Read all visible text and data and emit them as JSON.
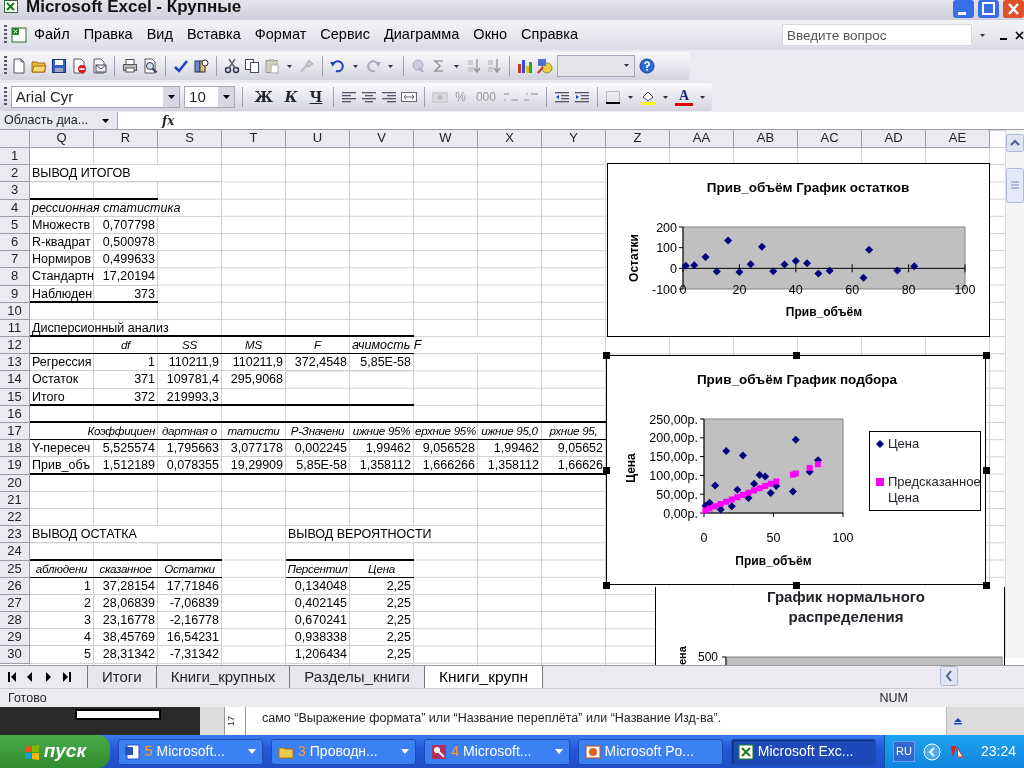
{
  "window": {
    "title": "Microsoft Excel - Крупные"
  },
  "menu": [
    "Файл",
    "Правка",
    "Вид",
    "Вставка",
    "Формат",
    "Сервис",
    "Диаграмма",
    "Окно",
    "Справка"
  ],
  "help_search": {
    "placeholder": "Введите вопрос"
  },
  "formatting": {
    "font": "Arial Cyr",
    "size": "10",
    "style_buttons": [
      "Ж",
      "К",
      "Ч"
    ],
    "number_buttons": [
      "%",
      "000"
    ],
    "font_color_button": "A"
  },
  "formula_bar": {
    "name_box": "Область диа...",
    "fx": "fx"
  },
  "columns": [
    "Q",
    "R",
    "S",
    "T",
    "U",
    "V",
    "W",
    "X",
    "Y",
    "Z",
    "AA",
    "AB",
    "AC",
    "AD",
    "AE"
  ],
  "rows": [
    {
      "number": "1"
    },
    {
      "number": "2",
      "cells": {
        "Q": {
          "kind": "text",
          "text": "ВЫВОД ИТОГОВ"
        }
      }
    },
    {
      "number": "3",
      "thick_rule": {
        "Q": true,
        "R": true
      }
    },
    {
      "number": "4",
      "cells": {
        "Q": {
          "kind": "italic-text",
          "text": "рессионная статистика"
        }
      }
    },
    {
      "number": "5",
      "cells": {
        "Q": {
          "kind": "text",
          "text": "Множеств"
        },
        "R": {
          "kind": "number",
          "text": "0,707798"
        }
      }
    },
    {
      "number": "6",
      "cells": {
        "Q": {
          "kind": "text",
          "text": "R-квадрат"
        },
        "R": {
          "kind": "number",
          "text": "0,500978"
        }
      }
    },
    {
      "number": "7",
      "cells": {
        "Q": {
          "kind": "text",
          "text": "Нормиров"
        },
        "R": {
          "kind": "number",
          "text": "0,499633"
        }
      }
    },
    {
      "number": "8",
      "cells": {
        "Q": {
          "kind": "text",
          "text": "Стандартн"
        },
        "R": {
          "kind": "number",
          "text": "17,20194"
        }
      }
    },
    {
      "number": "9",
      "cells": {
        "Q": {
          "kind": "text",
          "text": "Наблюден"
        },
        "R": {
          "kind": "number",
          "text": "373"
        }
      },
      "thick_rule": {
        "Q": true,
        "R": true
      }
    },
    {
      "number": "10"
    },
    {
      "number": "11",
      "cells": {
        "Q": {
          "kind": "text",
          "text": "Дисперсионный анализ"
        }
      },
      "thick_rule": {
        "Q": true,
        "R": true,
        "S": true,
        "T": true,
        "U": true,
        "V": true
      }
    },
    {
      "number": "12",
      "cells": {
        "R": {
          "kind": "heading",
          "text": "df"
        },
        "S": {
          "kind": "heading",
          "text": "SS"
        },
        "T": {
          "kind": "heading",
          "text": "MS"
        },
        "U": {
          "kind": "heading",
          "text": "F"
        },
        "V": {
          "kind": "italic-text",
          "text": "ачимость F"
        }
      },
      "thin_rule": {
        "Q": true,
        "R": true,
        "S": true,
        "T": true,
        "U": true,
        "V": true
      }
    },
    {
      "number": "13",
      "cells": {
        "Q": {
          "kind": "text",
          "text": "Регрессия"
        },
        "R": {
          "kind": "number",
          "text": "1"
        },
        "S": {
          "kind": "number",
          "text": "110211,9"
        },
        "T": {
          "kind": "number",
          "text": "110211,9"
        },
        "U": {
          "kind": "number",
          "text": "372,4548"
        },
        "V": {
          "kind": "number",
          "text": "5,85E-58"
        }
      }
    },
    {
      "number": "14",
      "cells": {
        "Q": {
          "kind": "text",
          "text": "Остаток"
        },
        "R": {
          "kind": "number",
          "text": "371"
        },
        "S": {
          "kind": "number",
          "text": "109781,4"
        },
        "T": {
          "kind": "number",
          "text": "295,9068"
        }
      }
    },
    {
      "number": "15",
      "cells": {
        "Q": {
          "kind": "text",
          "text": "Итого"
        },
        "R": {
          "kind": "number",
          "text": "372"
        },
        "S": {
          "kind": "number",
          "text": "219993,3"
        }
      },
      "thick_rule": {
        "Q": true,
        "R": true,
        "S": true,
        "T": true,
        "U": true,
        "V": true
      }
    },
    {
      "number": "16",
      "thick_rule": {
        "Q": true,
        "R": true,
        "S": true,
        "T": true,
        "U": true,
        "V": true,
        "W": true,
        "X": true,
        "Y": true
      }
    },
    {
      "number": "17",
      "cells": {
        "R": {
          "kind": "heading-right",
          "text": "Коэффициен"
        },
        "S": {
          "kind": "heading",
          "text": "дартная о"
        },
        "T": {
          "kind": "heading",
          "text": "татисти"
        },
        "U": {
          "kind": "heading",
          "text": "Р-Значени"
        },
        "V": {
          "kind": "heading",
          "text": "ижние 95%"
        },
        "W": {
          "kind": "heading",
          "text": "ерхние 95%"
        },
        "X": {
          "kind": "heading",
          "text": "ижние 95,0"
        },
        "Y": {
          "kind": "heading",
          "text": "рхние 95,"
        }
      },
      "thin_rule": {
        "Q": true,
        "R": true,
        "S": true,
        "T": true,
        "U": true,
        "V": true,
        "W": true,
        "X": true,
        "Y": true
      }
    },
    {
      "number": "18",
      "cells": {
        "Q": {
          "kind": "text",
          "text": "Y-пересеч"
        },
        "R": {
          "kind": "number",
          "text": "5,525574"
        },
        "S": {
          "kind": "number",
          "text": "1,795663"
        },
        "T": {
          "kind": "number",
          "text": "3,077178"
        },
        "U": {
          "kind": "number",
          "text": "0,002245"
        },
        "V": {
          "kind": "number",
          "text": "1,99462"
        },
        "W": {
          "kind": "number",
          "text": "9,056528"
        },
        "X": {
          "kind": "number",
          "text": "1,99462"
        },
        "Y": {
          "kind": "number",
          "text": "9,05652"
        }
      }
    },
    {
      "number": "19",
      "cells": {
        "Q": {
          "kind": "text",
          "text": "Прив_объ"
        },
        "R": {
          "kind": "number",
          "text": "1,512189"
        },
        "S": {
          "kind": "number",
          "text": "0,078355"
        },
        "T": {
          "kind": "number",
          "text": "19,29909"
        },
        "U": {
          "kind": "number",
          "text": "5,85E-58"
        },
        "V": {
          "kind": "number",
          "text": "1,358112"
        },
        "W": {
          "kind": "number",
          "text": "1,666266"
        },
        "X": {
          "kind": "number",
          "text": "1,358112"
        },
        "Y": {
          "kind": "number",
          "text": "1,66626"
        }
      },
      "thick_rule": {
        "Q": true,
        "R": true,
        "S": true,
        "T": true,
        "U": true,
        "V": true,
        "W": true,
        "X": true,
        "Y": true
      }
    },
    {
      "number": "20"
    },
    {
      "number": "21"
    },
    {
      "number": "22"
    },
    {
      "number": "23",
      "cells": {
        "Q": {
          "kind": "text",
          "text": "ВЫВОД ОСТАТКА"
        },
        "U": {
          "kind": "text",
          "text": "ВЫВОД ВЕРОЯТНОСТИ"
        }
      }
    },
    {
      "number": "24",
      "thick_rule": {
        "Q": true,
        "R": true,
        "S": true,
        "U": true,
        "V": true
      }
    },
    {
      "number": "25",
      "cells": {
        "Q": {
          "kind": "heading",
          "text": "аблюдени"
        },
        "R": {
          "kind": "heading",
          "text": "сказанное"
        },
        "S": {
          "kind": "heading",
          "text": "Остатки"
        },
        "U": {
          "kind": "heading",
          "text": "Персентил"
        },
        "V": {
          "kind": "heading",
          "text": "Цена"
        }
      },
      "thin_rule": {
        "Q": true,
        "R": true,
        "S": true,
        "U": true,
        "V": true
      }
    },
    {
      "number": "26",
      "cells": {
        "Q": {
          "kind": "number",
          "text": "1"
        },
        "R": {
          "kind": "number",
          "text": "37,28154"
        },
        "S": {
          "kind": "number",
          "text": "17,71846"
        },
        "U": {
          "kind": "number",
          "text": "0,134048"
        },
        "V": {
          "kind": "number",
          "text": "2,25"
        }
      }
    },
    {
      "number": "27",
      "cells": {
        "Q": {
          "kind": "number",
          "text": "2"
        },
        "R": {
          "kind": "number",
          "text": "28,06839"
        },
        "S": {
          "kind": "number",
          "text": "-7,06839"
        },
        "U": {
          "kind": "number",
          "text": "0,402145"
        },
        "V": {
          "kind": "number",
          "text": "2,25"
        }
      }
    },
    {
      "number": "28",
      "cells": {
        "Q": {
          "kind": "number",
          "text": "3"
        },
        "R": {
          "kind": "number",
          "text": "23,16778"
        },
        "S": {
          "kind": "number",
          "text": "-2,16778"
        },
        "U": {
          "kind": "number",
          "text": "0,670241"
        },
        "V": {
          "kind": "number",
          "text": "2,25"
        }
      }
    },
    {
      "number": "29",
      "cells": {
        "Q": {
          "kind": "number",
          "text": "4"
        },
        "R": {
          "kind": "number",
          "text": "38,45769"
        },
        "S": {
          "kind": "number",
          "text": "16,54231"
        },
        "U": {
          "kind": "number",
          "text": "0,938338"
        },
        "V": {
          "kind": "number",
          "text": "2,25"
        }
      }
    },
    {
      "number": "30",
      "cells": {
        "Q": {
          "kind": "number",
          "text": "5"
        },
        "R": {
          "kind": "number",
          "text": "28,31342"
        },
        "S": {
          "kind": "number",
          "text": "-7,31342"
        },
        "U": {
          "kind": "number",
          "text": "1,206434"
        },
        "V": {
          "kind": "number",
          "text": "2,25"
        }
      }
    }
  ],
  "charts": [
    {
      "selected": false,
      "chart_data": {
        "type": "scatter",
        "title": "Прив_объём График остатков",
        "xlabel": "Прив_объём",
        "ylabel": "Остатки",
        "xlim": [
          0,
          100
        ],
        "ylim": [
          -100,
          200
        ],
        "xticks": [
          {
            "value": 0,
            "label": "0"
          },
          {
            "value": 20,
            "label": "20"
          },
          {
            "value": 40,
            "label": "40"
          },
          {
            "value": 60,
            "label": "60"
          },
          {
            "value": 80,
            "label": "80"
          },
          {
            "value": 100,
            "label": "100"
          }
        ],
        "yticks": [
          {
            "value": -100,
            "label": "-100"
          },
          {
            "value": 0,
            "label": "0"
          },
          {
            "value": 100,
            "label": "100"
          },
          {
            "value": 200,
            "label": "200"
          }
        ],
        "x": [
          1,
          4,
          8,
          12,
          16,
          20,
          24,
          28,
          32,
          36,
          40,
          44,
          48,
          52,
          64,
          66,
          76,
          82
        ],
        "series": [
          {
            "color": "#000080",
            "values": [
              12,
              15,
              55,
              -15,
              135,
              -18,
              20,
              105,
              -14,
              18,
              35,
              25,
              -25,
              -12,
              -45,
              90,
              -10,
              10
            ]
          }
        ]
      }
    },
    {
      "selected": true,
      "chart_data": {
        "type": "scatter",
        "title": "Прив_объём График подбора",
        "xlabel": "Прив_объём",
        "ylabel": "Цена",
        "legend": "right",
        "xlim": [
          0,
          100
        ],
        "ylim": [
          0,
          250
        ],
        "xticks": [
          {
            "value": 0,
            "label": "0"
          },
          {
            "value": 50,
            "label": "50"
          },
          {
            "value": 100,
            "label": "100"
          }
        ],
        "yticks": [
          {
            "value": 0,
            "label": "0,00р."
          },
          {
            "value": 50,
            "label": "50,00р."
          },
          {
            "value": 100,
            "label": "100,00р."
          },
          {
            "value": 150,
            "label": "150,00р."
          },
          {
            "value": 200,
            "label": "200,00р."
          },
          {
            "value": 250,
            "label": "250,00р."
          }
        ],
        "x": [
          1,
          4,
          8,
          12,
          16,
          20,
          24,
          28,
          32,
          36,
          40,
          44,
          48,
          52,
          64,
          66,
          76,
          82
        ],
        "series": [
          {
            "name": "Цена",
            "color": "#000080",
            "values": [
              19,
              27,
              73,
              9,
              165,
              18,
              62,
              153,
              40,
              78,
              101,
              97,
              53,
              72,
              57,
              195,
              110,
              140
            ]
          },
          {
            "name": "Предсказанное Цена",
            "color": "#ff00ff",
            "values": [
              7,
              12,
              18,
              24,
              30,
              36,
              42,
              48,
              54,
              60,
              66,
              72,
              78,
              84,
              102,
              105,
              120,
              130
            ]
          }
        ]
      }
    },
    {
      "selected": false,
      "title": "График нормального распределения",
      "ylabel": "ена",
      "ytick": "500"
    }
  ],
  "sheet_tabs": [
    {
      "label": "Итоги",
      "selected": false
    },
    {
      "label": "Книги_крупных",
      "selected": false
    },
    {
      "label": "Разделы_книги",
      "selected": false
    },
    {
      "label": "Книги_крупн",
      "selected": true
    }
  ],
  "status_bar": {
    "left": "Готово",
    "right": "NUM"
  },
  "background_window": {
    "ruler_number": "17",
    "text": "само “Выражение формата” или “Название переплёта” или “Название Изд-ва”."
  },
  "taskbar": {
    "start": "пуск",
    "tasks": [
      {
        "kind": "word",
        "count": "5",
        "label": "Microsoft...",
        "selected": false
      },
      {
        "kind": "explorer",
        "count": "3",
        "label": "Проводн...",
        "selected": false
      },
      {
        "kind": "access",
        "count": "4",
        "label": "Microsoft...",
        "selected": false
      },
      {
        "kind": "powerpoint",
        "label": "Microsoft Po...",
        "selected": false
      },
      {
        "kind": "excel",
        "label": "Microsoft Exc...",
        "selected": true
      }
    ],
    "language": "RU",
    "clock": "23:24"
  }
}
